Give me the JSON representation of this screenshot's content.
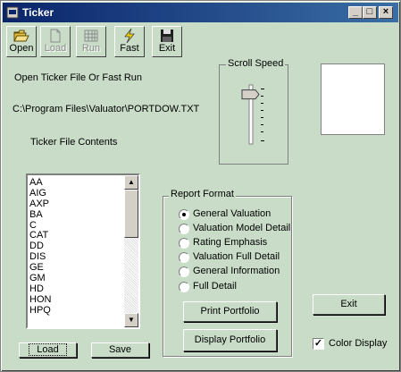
{
  "window": {
    "title": "Ticker"
  },
  "titlebar_buttons": {
    "minimize": "_",
    "maximize": "□",
    "close": "×"
  },
  "toolbar": [
    {
      "label": "Open",
      "icon": "folder-open-icon",
      "enabled": true
    },
    {
      "label": "Load",
      "icon": "document-icon",
      "enabled": false
    },
    {
      "label": "Run",
      "icon": "grid-run-icon",
      "enabled": false
    },
    {
      "label": "Fast",
      "icon": "lightning-icon",
      "enabled": true
    },
    {
      "label": "Exit",
      "icon": "floppy-disk-icon",
      "enabled": true
    }
  ],
  "status_text": "Open Ticker File Or Fast Run",
  "file_path": "C:\\Program Files\\Valuator\\PORTDOW.TXT",
  "list_label": "Ticker File  Contents",
  "tickers": [
    "AA",
    "AIG",
    "AXP",
    "BA",
    "C",
    "CAT",
    "DD",
    "DIS",
    "GE",
    "GM",
    "HD",
    "HON",
    "HPQ"
  ],
  "list_buttons": {
    "load": "Load",
    "save": "Save"
  },
  "scroll_speed": {
    "label": "Scroll Speed",
    "level": 0.1
  },
  "report_format": {
    "label": "Report Format",
    "options": [
      "General Valuation",
      "Valuation Model Detail",
      "Rating Emphasis",
      "Valuation Full Detail",
      "General Information",
      "Full Detail"
    ],
    "selected": "General Valuation"
  },
  "actions": {
    "print": "Print Portfolio",
    "display": "Display Portfolio",
    "exit": "Exit"
  },
  "color_display": {
    "label": "Color Display",
    "checked": true,
    "mark": "✓"
  },
  "colors": {
    "form_bg": "#c8dcc8",
    "titlebar_start": "#0a246a",
    "titlebar_end": "#3a6ea5"
  }
}
